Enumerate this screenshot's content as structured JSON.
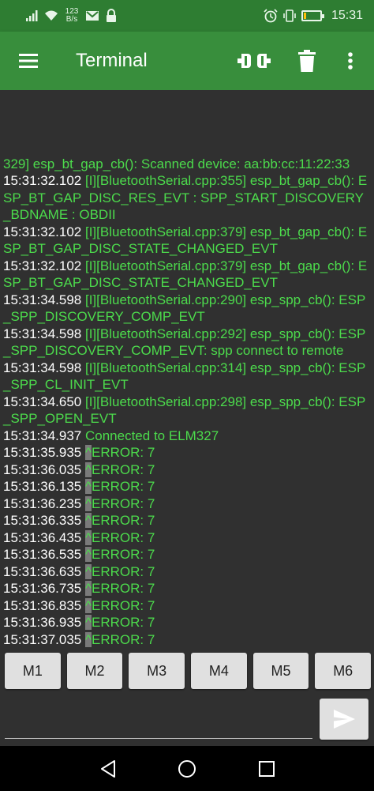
{
  "status_bar": {
    "net_speed_value": "123",
    "net_speed_unit": "B/s",
    "battery_level": "17",
    "battery_fraction": 0.17,
    "time": "15:31",
    "icons": [
      "signal-icon",
      "wifi-icon",
      "gmail-icon",
      "lock-icon",
      "alarm-icon",
      "vibrate-icon",
      "battery-icon"
    ]
  },
  "app_bar": {
    "title": "Terminal",
    "icons": [
      "menu-icon",
      "disconnect-icon",
      "trash-icon",
      "more-vert-icon"
    ]
  },
  "colors": {
    "app_bar": "#388e3c",
    "status_bar": "#2e7d32",
    "terminal_bg": "#303030",
    "timestamp_text": "#ffffff",
    "message_text": "#4cdb4c"
  },
  "terminal": {
    "lines": [
      {
        "ts": "",
        "msg": "329] esp_bt_gap_cb(): Scanned device: aa:bb:cc:11:22:33"
      },
      {
        "ts": "15:31:32.102",
        "msg": " [I][BluetoothSerial.cpp:355] esp_bt_gap_cb(): ESP_BT_GAP_DISC_RES_EVT : SPP_START_DISCOVERY_BDNAME : OBDII"
      },
      {
        "ts": "15:31:32.102",
        "msg": " [I][BluetoothSerial.cpp:379] esp_bt_gap_cb(): ESP_BT_GAP_DISC_STATE_CHANGED_EVT"
      },
      {
        "ts": "15:31:32.102",
        "msg": " [I][BluetoothSerial.cpp:379] esp_bt_gap_cb(): ESP_BT_GAP_DISC_STATE_CHANGED_EVT"
      },
      {
        "ts": "15:31:34.598",
        "msg": " [I][BluetoothSerial.cpp:290] esp_spp_cb(): ESP_SPP_DISCOVERY_COMP_EVT"
      },
      {
        "ts": "15:31:34.598",
        "msg": " [I][BluetoothSerial.cpp:292] esp_spp_cb(): ESP_SPP_DISCOVERY_COMP_EVT: spp connect to remote"
      },
      {
        "ts": "15:31:34.598",
        "msg": " [I][BluetoothSerial.cpp:314] esp_spp_cb(): ESP_SPP_CL_INIT_EVT"
      },
      {
        "ts": "15:31:34.650",
        "msg": " [I][BluetoothSerial.cpp:298] esp_spp_cb(): ESP_SPP_OPEN_EVT"
      },
      {
        "ts": "15:31:34.937",
        "msg": " Connected to ELM327"
      },
      {
        "ts": "15:31:35.935",
        "caret": "^",
        "msg": "ERROR: 7"
      },
      {
        "ts": "15:31:36.035",
        "caret": "^",
        "msg": "ERROR: 7"
      },
      {
        "ts": "15:31:36.135",
        "caret": "^",
        "msg": "ERROR: 7"
      },
      {
        "ts": "15:31:36.235",
        "caret": "^",
        "msg": "ERROR: 7"
      },
      {
        "ts": "15:31:36.335",
        "caret": "^",
        "msg": "ERROR: 7"
      },
      {
        "ts": "15:31:36.435",
        "caret": "^",
        "msg": "ERROR: 7"
      },
      {
        "ts": "15:31:36.535",
        "caret": "^",
        "msg": "ERROR: 7"
      },
      {
        "ts": "15:31:36.635",
        "caret": "^",
        "msg": "ERROR: 7"
      },
      {
        "ts": "15:31:36.735",
        "caret": "^",
        "msg": "ERROR: 7"
      },
      {
        "ts": "15:31:36.835",
        "caret": "^",
        "msg": "ERROR: 7"
      },
      {
        "ts": "15:31:36.935",
        "caret": "^",
        "msg": "ERROR: 7"
      },
      {
        "ts": "15:31:37.035",
        "caret": "^",
        "msg": "ERROR: 7"
      }
    ]
  },
  "macros": [
    "M1",
    "M2",
    "M3",
    "M4",
    "M5",
    "M6"
  ],
  "input": {
    "value": "",
    "placeholder": "",
    "send_icon": "send-icon"
  },
  "nav_bar": {
    "icons": [
      "back-icon",
      "home-icon",
      "recents-icon"
    ]
  }
}
